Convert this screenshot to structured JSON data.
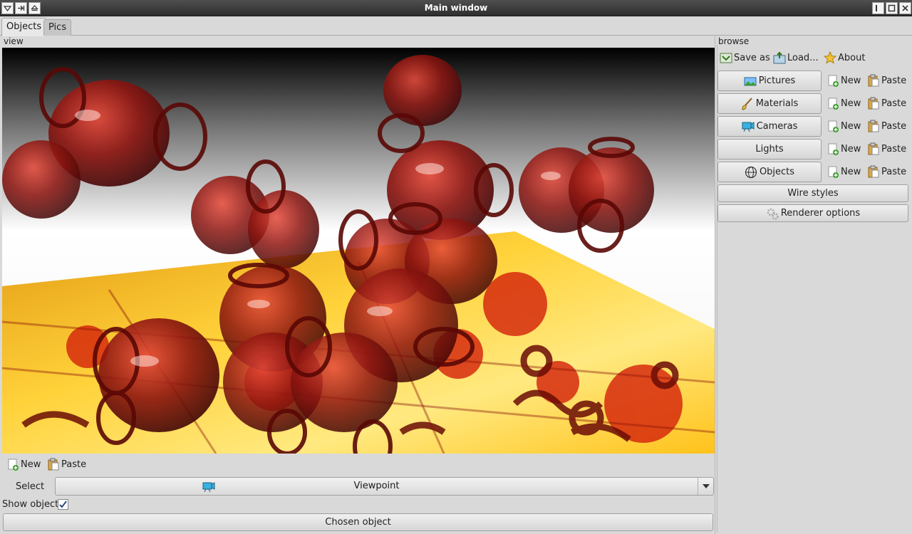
{
  "window": {
    "title": "Main window"
  },
  "tabs": [
    {
      "label": "Objects"
    },
    {
      "label": "Pics"
    }
  ],
  "view": {
    "group_label": "view"
  },
  "browse": {
    "group_label": "browse",
    "toolbar": {
      "save_as": "Save as",
      "load": "Load...",
      "about": "About"
    },
    "categories": [
      {
        "label": "Pictures",
        "icon": "picture-icon"
      },
      {
        "label": "Materials",
        "icon": "brush-icon"
      },
      {
        "label": "Cameras",
        "icon": "camera-icon"
      },
      {
        "label": "Lights",
        "icon": ""
      },
      {
        "label": "Objects",
        "icon": "globe-icon"
      }
    ],
    "new_label": "New",
    "paste_label": "Paste",
    "wire_styles": "Wire styles",
    "renderer_options": "Renderer options"
  },
  "bottom": {
    "new_label": "New",
    "paste_label": "Paste",
    "select_label": "Select",
    "select_value": "Viewpoint",
    "show_object_label": "Show object",
    "show_object_checked": true,
    "chosen_object": "Chosen object"
  }
}
